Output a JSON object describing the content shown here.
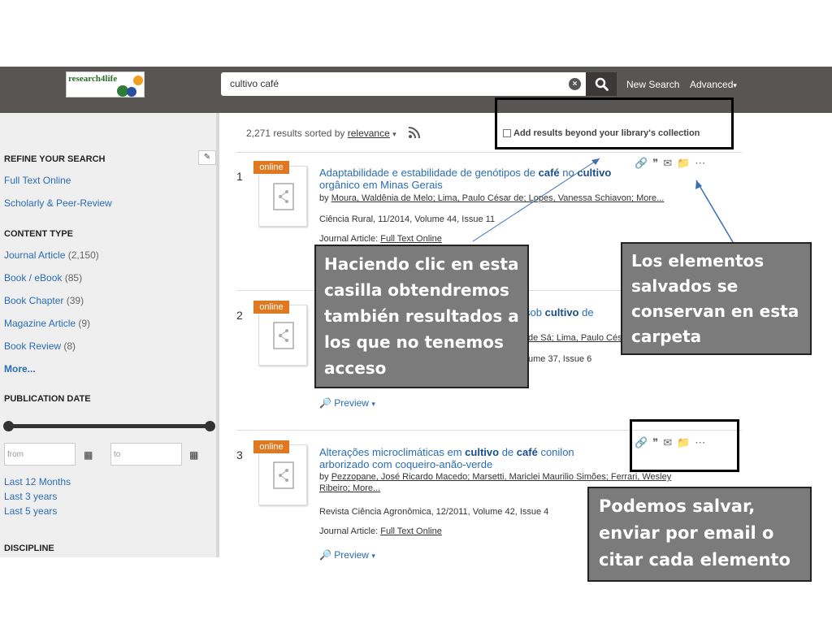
{
  "header": {
    "logo_text": "research4life",
    "search_value": "cultivo café",
    "links": {
      "new_search": "New Search",
      "advanced": "Advanced"
    },
    "colors": {
      "bar": "#595555"
    }
  },
  "sidebar": {
    "refine_heading": "REFINE YOUR SEARCH",
    "refine_links": [
      "Full Text Online",
      "Scholarly & Peer-Review"
    ],
    "content_type_heading": "CONTENT TYPE",
    "content_types": [
      {
        "label": "Journal Article",
        "count": "(2,150)"
      },
      {
        "label": "Book / eBook",
        "count": "(85)"
      },
      {
        "label": "Book Chapter",
        "count": "(39)"
      },
      {
        "label": "Magazine Article",
        "count": "(9)"
      },
      {
        "label": "Book Review",
        "count": "(8)"
      }
    ],
    "more_label": "More...",
    "pubdate_heading": "PUBLICATION DATE",
    "from_placeholder": "from",
    "to_placeholder": "to",
    "date_links": [
      "Last 12 Months",
      "Last 3 years",
      "Last 5 years"
    ],
    "discipline_heading": "DISCIPLINE"
  },
  "results": {
    "count_text": "2,271 results sorted by",
    "sort_value": "relevance",
    "beyond_label": "Add results beyond your library's collection",
    "items": [
      {
        "num": "1",
        "badge": "online",
        "title_pre": "Adaptabilidade e estabilidade de genótipos de",
        "title_b1": "café",
        "title_mid": "no",
        "title_b2": "cultivo",
        "title_post": "orgânico em Minas Gerais",
        "authors_prefix": "by",
        "authors": "Moura, Waldênia de Melo; Lima, Paulo César de; Lopes, Vanessa Schiavon; More...",
        "source": "Ciência Rural, 11/2014, Volume 44, Issue 11",
        "type_label": "Journal Article:",
        "type_link": "Full Text Online"
      },
      {
        "num": "2",
        "badge": "online",
        "title_pre": "sob",
        "title_b1": "cultivo",
        "title_mid": "de",
        "authors": "de Sá; Lima, Paulo Cés",
        "source": "ume 37, Issue 6",
        "preview": "Preview"
      },
      {
        "num": "3",
        "badge": "online",
        "title_pre": "Alterações microclimáticas em",
        "title_b1": "cultivo",
        "title_mid": "de",
        "title_b2": "café",
        "title_post": "conilon arborizado com coqueiro-anão-verde",
        "authors_prefix": "by",
        "authors": "Pezzopane, José Ricardo Macedo; Marsetti, Mariclei Maurilio Simões; Ferrari, Wesley Ribeiro; More...",
        "source": "Revista Ciência Agronômica, 12/2011, Volume 42, Issue 4",
        "type_label": "Journal Article:",
        "type_link": "Full Text Online",
        "preview": "Preview"
      }
    ]
  },
  "annotations": {
    "checkbox_note": "Haciendo clic en esta casilla obtendremos también resultados a los que no tenemos acceso",
    "folder_note": "Los elementos salvados se conservan en esta carpeta",
    "actions_note": "Podemos salvar, enviar por email  o citar cada elemento"
  }
}
